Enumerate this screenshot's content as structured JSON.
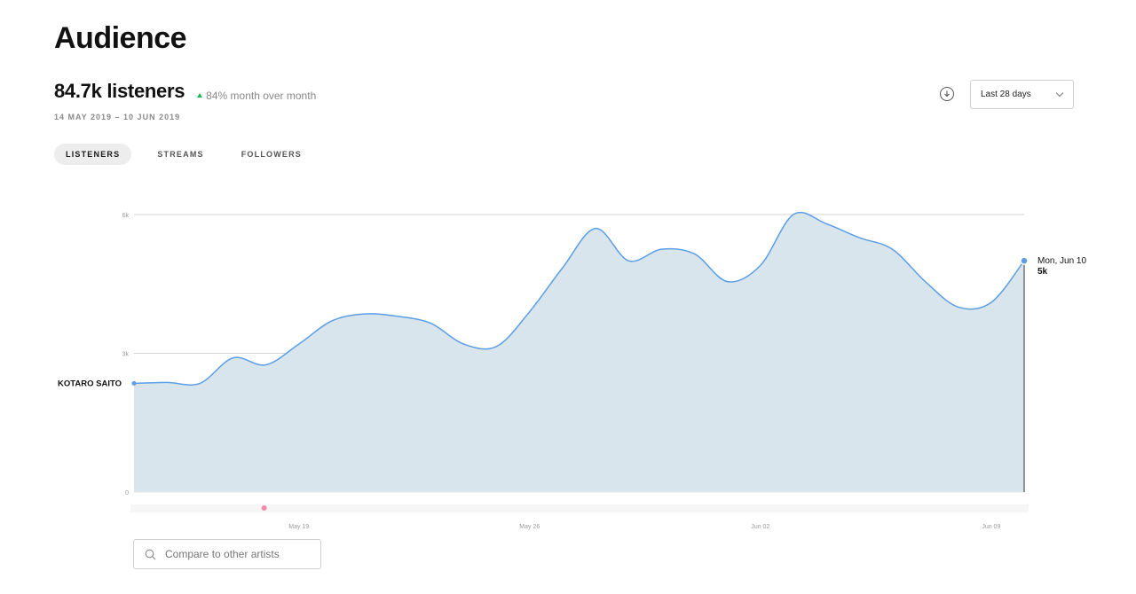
{
  "page": {
    "title": "Audience",
    "listeners_total": "84.7k listeners",
    "month_over_month": "84% month over month",
    "date_range": "14 MAY 2019 – 10 JUN 2019"
  },
  "tabs": [
    {
      "label": "LISTENERS",
      "active": true
    },
    {
      "label": "STREAMS",
      "active": false
    },
    {
      "label": "FOLLOWERS",
      "active": false
    }
  ],
  "controls": {
    "period_label": "Last 28 days",
    "download_icon": "download-icon",
    "compare_placeholder": "Compare to other artists",
    "search_icon": "search-icon"
  },
  "colors": {
    "line": "#5b9ee6",
    "fill": "#d8e5ec",
    "grid": "#d4d4d4",
    "accent_up": "#1db954",
    "marker_pink": "#f08ca8"
  },
  "chart_data": {
    "type": "area",
    "series": [
      {
        "name": "KOTARO SAITO",
        "x": [
          "2019-05-14",
          "2019-05-15",
          "2019-05-16",
          "2019-05-17",
          "2019-05-18",
          "2019-05-19",
          "2019-05-20",
          "2019-05-21",
          "2019-05-22",
          "2019-05-23",
          "2019-05-24",
          "2019-05-25",
          "2019-05-26",
          "2019-05-27",
          "2019-05-28",
          "2019-05-29",
          "2019-05-30",
          "2019-05-31",
          "2019-06-01",
          "2019-06-02",
          "2019-06-03",
          "2019-06-04",
          "2019-06-05",
          "2019-06-06",
          "2019-06-07",
          "2019-06-08",
          "2019-06-09",
          "2019-06-10"
        ],
        "values": [
          2350,
          2370,
          2350,
          2900,
          2750,
          3200,
          3700,
          3850,
          3800,
          3650,
          3200,
          3150,
          3900,
          4850,
          5700,
          5000,
          5250,
          5150,
          4550,
          4900,
          6000,
          5800,
          5500,
          5250,
          4550,
          4000,
          4100,
          5000
        ]
      }
    ],
    "y_ticks": [
      "0",
      "3k",
      "6k"
    ],
    "y_tick_values": [
      0,
      3000,
      6000
    ],
    "ylim": [
      0,
      6000
    ],
    "x_ticks": [
      "May 19",
      "May 26",
      "Jun 02",
      "Jun 09"
    ],
    "x_tick_dates": [
      "2019-05-19",
      "2019-05-26",
      "2019-06-02",
      "2019-06-09"
    ],
    "tooltip": {
      "date": "Mon, Jun 10",
      "value": "5k"
    },
    "series_label": "KOTARO SAITO",
    "event_marker_date": "2019-05-18",
    "grid": true,
    "legend": "none"
  }
}
